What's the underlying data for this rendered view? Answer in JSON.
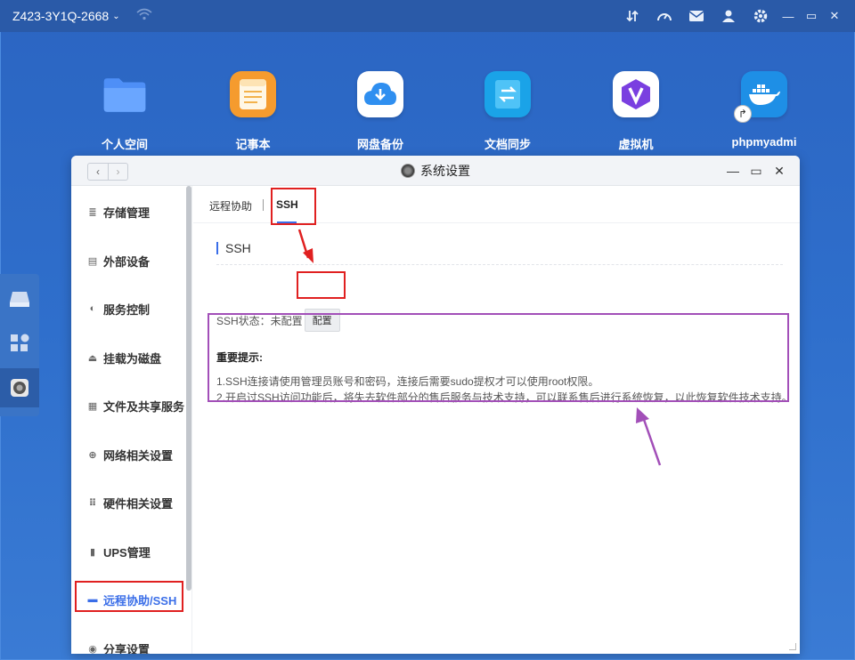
{
  "topbar": {
    "device_name": "Z423-3Y1Q-2668",
    "icons": [
      "wifi-icon",
      "transfer-icon",
      "speedometer-icon",
      "mail-icon",
      "user-icon",
      "gear-icon"
    ],
    "window_controls": [
      "minimize",
      "maximize",
      "close"
    ]
  },
  "desktop": {
    "apps": [
      {
        "label": "个人空间",
        "icon": "folder-icon",
        "color": "#4e8ff7"
      },
      {
        "label": "记事本",
        "icon": "notepad-icon",
        "color": "#f59b2e"
      },
      {
        "label": "网盘备份",
        "icon": "cloud-download-icon",
        "color": "#2f8ff0"
      },
      {
        "label": "文档同步",
        "icon": "sync-icon",
        "color": "#1aa3e8"
      },
      {
        "label": "虚拟机",
        "icon": "vm-icon",
        "color": "#7a3fe0"
      },
      {
        "label": "phpmyadmi",
        "icon": "docker-icon",
        "color": "#1e8fe6"
      }
    ]
  },
  "window": {
    "title": "系统设置",
    "sidebar": {
      "items": [
        {
          "label": "存储管理",
          "icon": "database-icon"
        },
        {
          "label": "外部设备",
          "icon": "device-icon"
        },
        {
          "label": "服务控制",
          "icon": "toggle-icon"
        },
        {
          "label": "挂载为磁盘",
          "icon": "disk-icon"
        },
        {
          "label": "文件及共享服务",
          "icon": "file-icon"
        },
        {
          "label": "网络相关设置",
          "icon": "globe-icon"
        },
        {
          "label": "硬件相关设置",
          "icon": "grid-icon"
        },
        {
          "label": "UPS管理",
          "icon": "battery-icon"
        },
        {
          "label": "远程协助/SSH",
          "icon": "monitor-icon",
          "active": true
        },
        {
          "label": "分享设置",
          "icon": "share-icon"
        }
      ]
    },
    "tabs": [
      {
        "label": "远程协助"
      },
      {
        "label": "SSH",
        "active": true
      }
    ],
    "section_title": "SSH",
    "ssh_status_label": "SSH状态：未配置",
    "configure_button": "配置",
    "notice": {
      "title": "重要提示:",
      "lines": [
        "1.SSH连接请使用管理员账号和密码，连接后需要sudo提权才可以使用root权限。",
        "2.开启过SSH访问功能后，将失去软件部分的售后服务与技术支持，可以联系售后进行系统恢复，以此恢复软件技术支持。"
      ]
    }
  },
  "colors": {
    "accent": "#3a6ee8",
    "annotation_red": "#e02020",
    "annotation_purple": "#a24fb8",
    "desktop_bg": "#2f6fcc"
  }
}
